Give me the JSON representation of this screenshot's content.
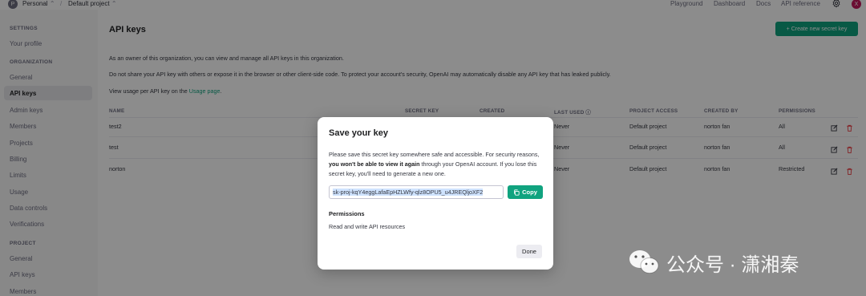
{
  "topbar": {
    "org_initial": "P",
    "org": "Personal",
    "org_chevron": "⌃",
    "separator": "/",
    "project": "Default project",
    "project_chevron": "⌃",
    "links": [
      "Playground",
      "Dashboard",
      "Docs",
      "API reference"
    ],
    "gear_icon": "gear-icon",
    "user_initial": "X"
  },
  "sidebar": {
    "settings_header": "SETTINGS",
    "settings_items": [
      "Your profile"
    ],
    "org_header": "ORGANIZATION",
    "org_items": [
      "General",
      "API keys",
      "Admin keys",
      "Members",
      "Projects",
      "Billing",
      "Limits",
      "Usage",
      "Data controls",
      "Verifications"
    ],
    "project_header": "PROJECT",
    "project_items": [
      "General",
      "API keys",
      "Members"
    ]
  },
  "main": {
    "title": "API keys",
    "create_button": "+ Create new secret key",
    "para1": "As an owner of this organization, you can view and manage all API keys in this organization.",
    "para2": "Do not share your API key with others or expose it in the browser or other client-side code. To protect your account's security, OpenAI may automatically disable any API key that has leaked publicly.",
    "para3_prefix": "View usage per API key on the ",
    "para3_link": "Usage page",
    "para3_suffix": ".",
    "headers": {
      "name": "NAME",
      "secret_key": "SECRET KEY",
      "created": "CREATED",
      "last_used": "LAST USED ⓘ",
      "project_access": "PROJECT ACCESS",
      "created_by": "CREATED BY",
      "permissions": "PERMISSIONS"
    },
    "rows": [
      {
        "name": "test2",
        "last_used": "Never",
        "project": "Default project",
        "created_by": "norton fan",
        "permissions": "All"
      },
      {
        "name": "test",
        "last_used": "Never",
        "project": "Default project",
        "created_by": "norton fan",
        "permissions": "All"
      },
      {
        "name": "norton",
        "last_used": "Never",
        "project": "Default project",
        "created_by": "norton fan",
        "permissions": "Restricted"
      }
    ]
  },
  "modal": {
    "title": "Save your key",
    "desc_1": "Please save this secret key somewhere safe and accessible. For security reasons, ",
    "desc_bold": "you won't be able to view it again",
    "desc_2": " through your OpenAI account. If you lose this secret key, you'll need to generate a new one.",
    "key_value": "sk-proj-kqY4eggLafaEpHZLWfy-qlz8OPU5_u4JREQljoXF2",
    "copy_label": "Copy",
    "permissions_label": "Permissions",
    "permissions_value": "Read and write API resources",
    "done_label": "Done"
  },
  "watermark": {
    "text": "公众号 · 潇湘秦"
  },
  "colors": {
    "accent": "#10a37f",
    "danger": "#ef4146"
  }
}
